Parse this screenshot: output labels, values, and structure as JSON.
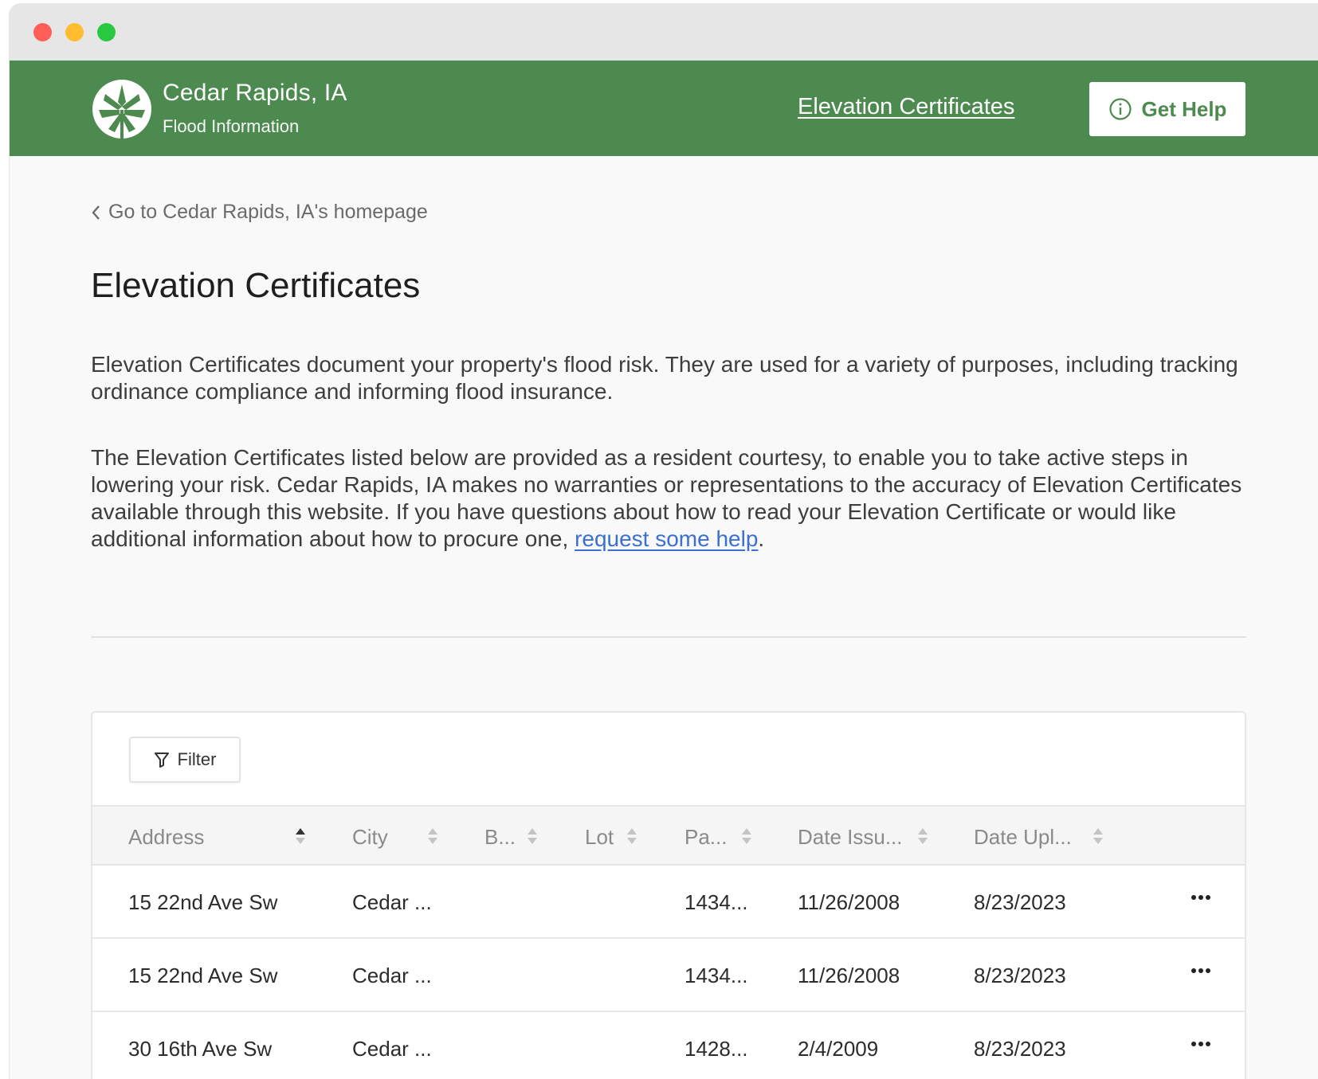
{
  "header": {
    "brand_title": "Cedar Rapids, IA",
    "brand_subtitle": "Flood Information",
    "nav_link": "Elevation Certificates",
    "help_button": "Get Help"
  },
  "content": {
    "back_link": "Go to Cedar Rapids, IA's homepage",
    "title": "Elevation Certificates",
    "paragraph1": "Elevation Certificates document your property's flood risk. They are used for a variety of purposes, including tracking ordinance compliance and informing flood insurance.",
    "paragraph2_text": "The Elevation Certificates listed below are provided as a resident courtesy, to enable you to take active steps in lowering your risk. Cedar Rapids, IA makes no warranties or representations to the accuracy of Elevation Certificates available through this website. If you have questions about how to read your Elevation Certificate or would like additional information about how to procure one, ",
    "paragraph2_link": "request some help",
    "paragraph2_end": "."
  },
  "table": {
    "filter_label": "Filter",
    "columns": [
      "Address",
      "City",
      "B...",
      "Lot",
      "Pa...",
      "Date Issu...",
      "Date Upl..."
    ],
    "rows": [
      [
        "15 22nd Ave Sw",
        "Cedar ...",
        "",
        "",
        "1434...",
        "11/26/2008",
        "8/23/2023"
      ],
      [
        "15 22nd Ave Sw",
        "Cedar ...",
        "",
        "",
        "1434...",
        "11/26/2008",
        "8/23/2023"
      ],
      [
        "30 16th Ave Sw",
        "Cedar ...",
        "",
        "",
        "1428...",
        "2/4/2009",
        "8/23/2023"
      ]
    ]
  },
  "colors": {
    "brand_green": "#4c8a4f",
    "link_blue": "#3b6fd1"
  },
  "icons": [
    "logo-icon",
    "info-icon",
    "chevron-left-icon",
    "filter-icon",
    "sort-icon",
    "more-icon"
  ]
}
